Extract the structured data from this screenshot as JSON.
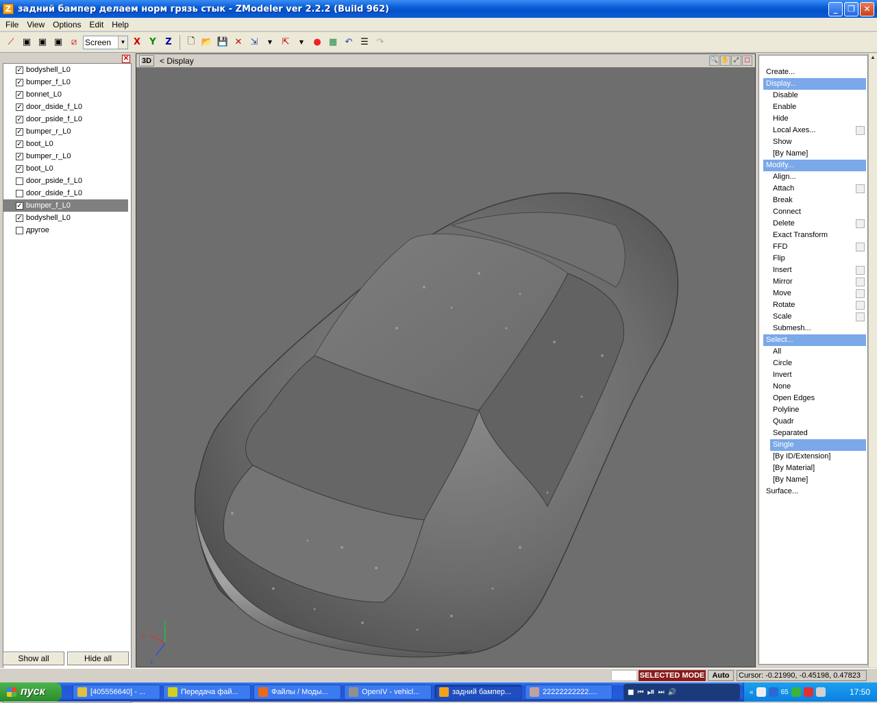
{
  "window": {
    "title": "задний бампер делаем норм грязь стык - ZModeler ver 2.2.2 (Build 962)",
    "icon_letter": "Z",
    "buttons": {
      "minimize": "_",
      "maximize": "❐",
      "close": "✕"
    }
  },
  "menu": [
    "File",
    "View",
    "Options",
    "Edit",
    "Help"
  ],
  "toolbar": {
    "view_combo": "Screen",
    "axis_x": "X",
    "axis_y": "Y",
    "axis_z": "Z"
  },
  "objects": {
    "items": [
      {
        "label": "bodyshell_L0",
        "checked": true
      },
      {
        "label": "bumper_f_L0",
        "checked": true
      },
      {
        "label": "bonnet_L0",
        "checked": true
      },
      {
        "label": "door_dside_f_L0",
        "checked": true
      },
      {
        "label": "door_pside_f_L0",
        "checked": true
      },
      {
        "label": "bumper_r_L0",
        "checked": true
      },
      {
        "label": "boot_L0",
        "checked": true
      },
      {
        "label": "bumper_r_L0",
        "checked": true
      },
      {
        "label": "boot_L0",
        "checked": true
      },
      {
        "label": "door_pside_f_L0",
        "checked": false
      },
      {
        "label": "door_dside_f_L0",
        "checked": false
      },
      {
        "label": "bumper_f_L0",
        "checked": true,
        "selected": true
      },
      {
        "label": "bodyshell_L0",
        "checked": true
      },
      {
        "label": "другое",
        "checked": false
      }
    ],
    "show_all": "Show all",
    "hide_all": "Hide all"
  },
  "viewport": {
    "mode": "3D",
    "label": "<  Display",
    "axes": {
      "x": "x",
      "y": "y",
      "z": "z"
    }
  },
  "commands": [
    {
      "label": "Create...",
      "kind": "top"
    },
    {
      "label": "Display...",
      "kind": "head"
    },
    {
      "label": "Disable",
      "kind": "sub"
    },
    {
      "label": "Enable",
      "kind": "sub"
    },
    {
      "label": "Hide",
      "kind": "sub"
    },
    {
      "label": "Local Axes...",
      "kind": "sub",
      "box": true
    },
    {
      "label": "Show",
      "kind": "sub"
    },
    {
      "label": "[By Name]",
      "kind": "sub"
    },
    {
      "label": "Modify...",
      "kind": "head"
    },
    {
      "label": "Align...",
      "kind": "sub"
    },
    {
      "label": "Attach",
      "kind": "sub",
      "box": true
    },
    {
      "label": "Break",
      "kind": "sub"
    },
    {
      "label": "Connect",
      "kind": "sub"
    },
    {
      "label": "Delete",
      "kind": "sub",
      "box": true
    },
    {
      "label": "Exact Transform",
      "kind": "sub"
    },
    {
      "label": "FFD",
      "kind": "sub",
      "box": true
    },
    {
      "label": "Flip",
      "kind": "sub"
    },
    {
      "label": "Insert",
      "kind": "sub",
      "box": true
    },
    {
      "label": "Mirror",
      "kind": "sub",
      "box": true
    },
    {
      "label": "Move",
      "kind": "sub",
      "box": true
    },
    {
      "label": "Rotate",
      "kind": "sub",
      "box": true
    },
    {
      "label": "Scale",
      "kind": "sub",
      "box": true
    },
    {
      "label": "Submesh...",
      "kind": "sub"
    },
    {
      "label": "Select...",
      "kind": "head"
    },
    {
      "label": "All",
      "kind": "sub"
    },
    {
      "label": "Circle",
      "kind": "sub"
    },
    {
      "label": "Invert",
      "kind": "sub"
    },
    {
      "label": "None",
      "kind": "sub"
    },
    {
      "label": "Open Edges",
      "kind": "sub"
    },
    {
      "label": "Polyline",
      "kind": "sub"
    },
    {
      "label": "Quadr",
      "kind": "sub"
    },
    {
      "label": "Separated",
      "kind": "sub"
    },
    {
      "label": "Single",
      "kind": "hl"
    },
    {
      "label": "[By ID/Extension]",
      "kind": "sub"
    },
    {
      "label": "[By Material]",
      "kind": "sub"
    },
    {
      "label": "[By Name]",
      "kind": "sub"
    },
    {
      "label": "Surface...",
      "kind": "top"
    }
  ],
  "status": {
    "mode": "SELECTED MODE",
    "auto": "Auto",
    "cursor": "Cursor: -0.21990, -0.45198, 0.47823"
  },
  "taskbar": {
    "start": "пуск",
    "tasks": [
      {
        "label": "[405556640] - ...",
        "color": "#e0c040"
      },
      {
        "label": "Передача фай...",
        "color": "#d0d020"
      },
      {
        "label": "Файлы / Моды...",
        "color": "#e86a1a"
      },
      {
        "label": "OpenIV - vehicl...",
        "color": "#909090"
      },
      {
        "label": "задний бампер...",
        "color": "#f3a21a",
        "active": true
      },
      {
        "label": "22222222222....",
        "color": "#c0a0a0"
      }
    ],
    "tray_num": "65",
    "clock": "17:50"
  },
  "colors": {
    "title_bar": "#0a5fd8",
    "selection": "#7aa8e8",
    "selected_mode": "#8b1a1a",
    "viewport_bg": "#6e6e6e"
  }
}
